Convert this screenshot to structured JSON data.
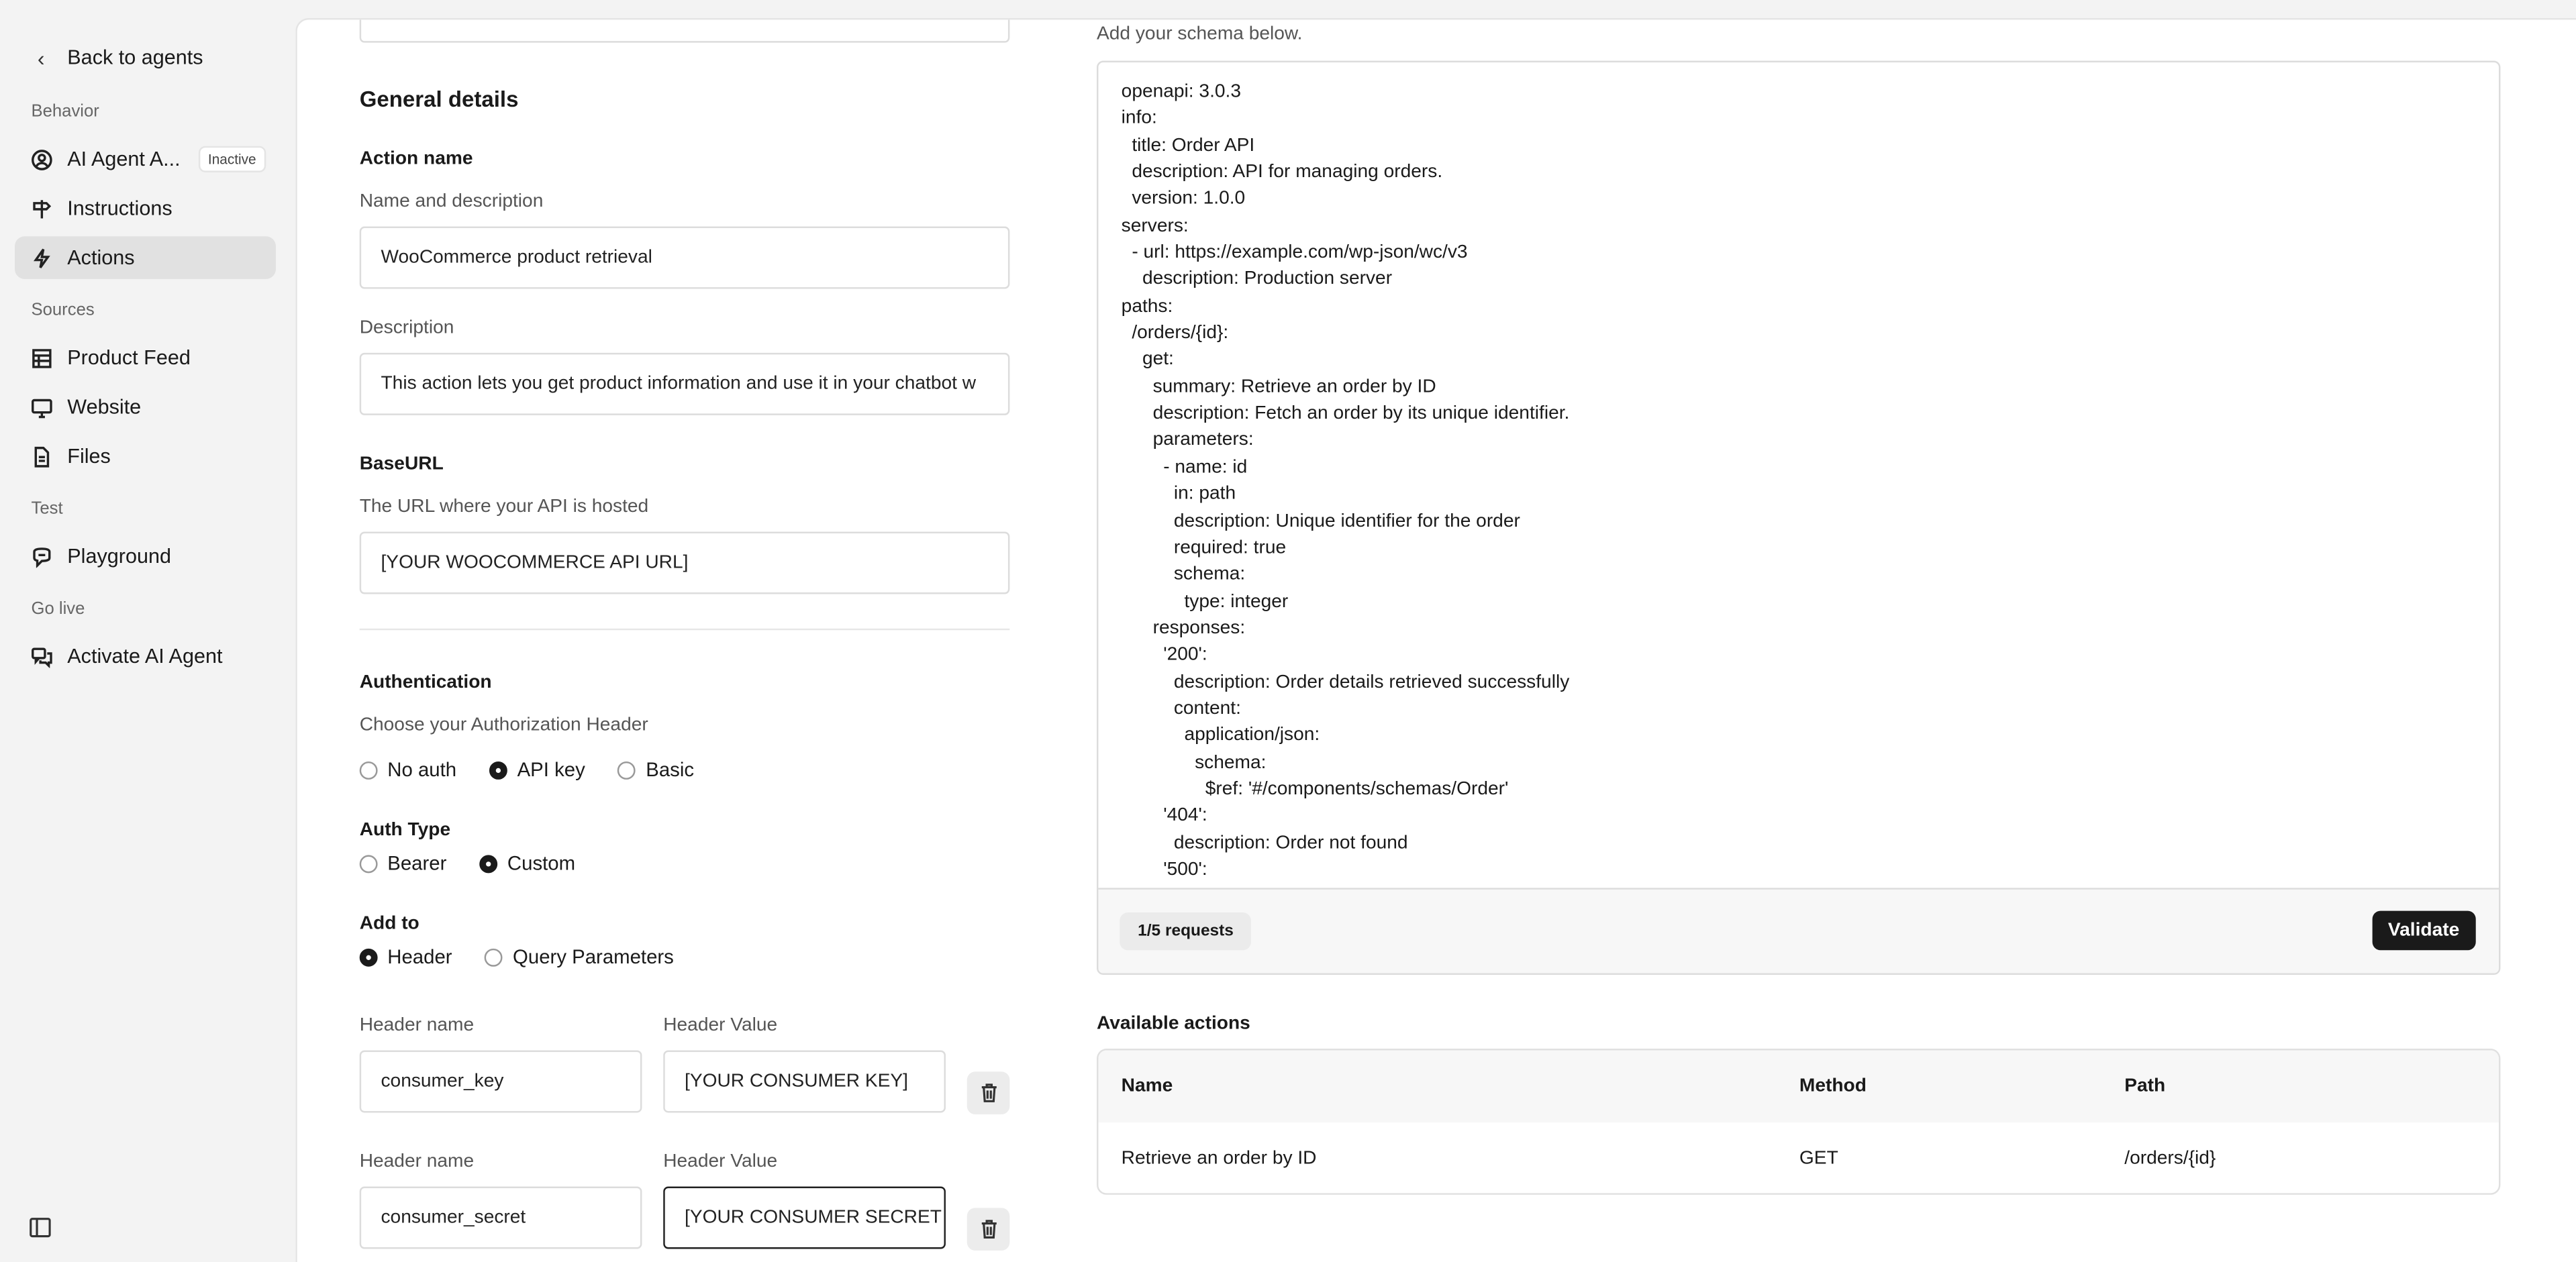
{
  "sidebar": {
    "back_label": "Back to agents",
    "sections": {
      "behavior": "Behavior",
      "sources": "Sources",
      "test": "Test",
      "go_live": "Go live"
    },
    "items": {
      "agent": {
        "label": "AI Agent A...",
        "badge": "Inactive",
        "icon": "user-circle-icon"
      },
      "instructions": {
        "label": "Instructions",
        "icon": "signpost-icon"
      },
      "actions": {
        "label": "Actions",
        "icon": "lightning-icon"
      },
      "product_feed": {
        "label": "Product Feed",
        "icon": "table-icon"
      },
      "website": {
        "label": "Website",
        "icon": "monitor-icon"
      },
      "files": {
        "label": "Files",
        "icon": "file-icon"
      },
      "playground": {
        "label": "Playground",
        "icon": "chat-bubble-icon"
      },
      "activate": {
        "label": "Activate AI Agent",
        "icon": "chat-bubbles-icon"
      }
    }
  },
  "form": {
    "general_title": "General details",
    "action_name_title": "Action name",
    "name_label": "Name and description",
    "name_value": "WooCommerce product retrieval",
    "description_label": "Description",
    "description_value": "This action lets you get product information and use it in your chatbot w",
    "baseurl_title": "BaseURL",
    "baseurl_label": "The URL where your API is hosted",
    "baseurl_value": "[YOUR WOOCOMMERCE API URL]",
    "auth_title": "Authentication",
    "auth_label": "Choose your Authorization Header",
    "auth_options": [
      "No auth",
      "API key",
      "Basic"
    ],
    "auth_selected": "API key",
    "auth_type_title": "Auth Type",
    "auth_type_options": [
      "Bearer",
      "Custom"
    ],
    "auth_type_selected": "Custom",
    "add_to_title": "Add to",
    "add_to_options": [
      "Header",
      "Query Parameters"
    ],
    "add_to_selected": "Header",
    "headers": [
      {
        "name_label": "Header name",
        "value_label": "Header Value",
        "name": "consumer_key",
        "value": "[YOUR CONSUMER KEY]"
      },
      {
        "name_label": "Header name",
        "value_label": "Header Value",
        "name": "consumer_secret",
        "value": "[YOUR CONSUMER SECRET"
      }
    ]
  },
  "schema": {
    "hint": "Add your schema below.",
    "code": "openapi: 3.0.3\ninfo:\n  title: Order API\n  description: API for managing orders.\n  version: 1.0.0\nservers:\n  - url: https://example.com/wp-json/wc/v3\n    description: Production server\npaths:\n  /orders/{id}:\n    get:\n      summary: Retrieve an order by ID\n      description: Fetch an order by its unique identifier.\n      parameters:\n        - name: id\n          in: path\n          description: Unique identifier for the order\n          required: true\n          schema:\n            type: integer\n      responses:\n        '200':\n          description: Order details retrieved successfully\n          content:\n            application/json:\n              schema:\n                $ref: '#/components/schemas/Order'\n        '404':\n          description: Order not found\n        '500':",
    "requests_label": "1/5 requests",
    "validate_label": "Validate"
  },
  "actions_table": {
    "title": "Available actions",
    "columns": [
      "Name",
      "Method",
      "Path"
    ],
    "rows": [
      [
        "Retrieve an order by ID",
        "GET",
        "/orders/{id}"
      ]
    ]
  }
}
